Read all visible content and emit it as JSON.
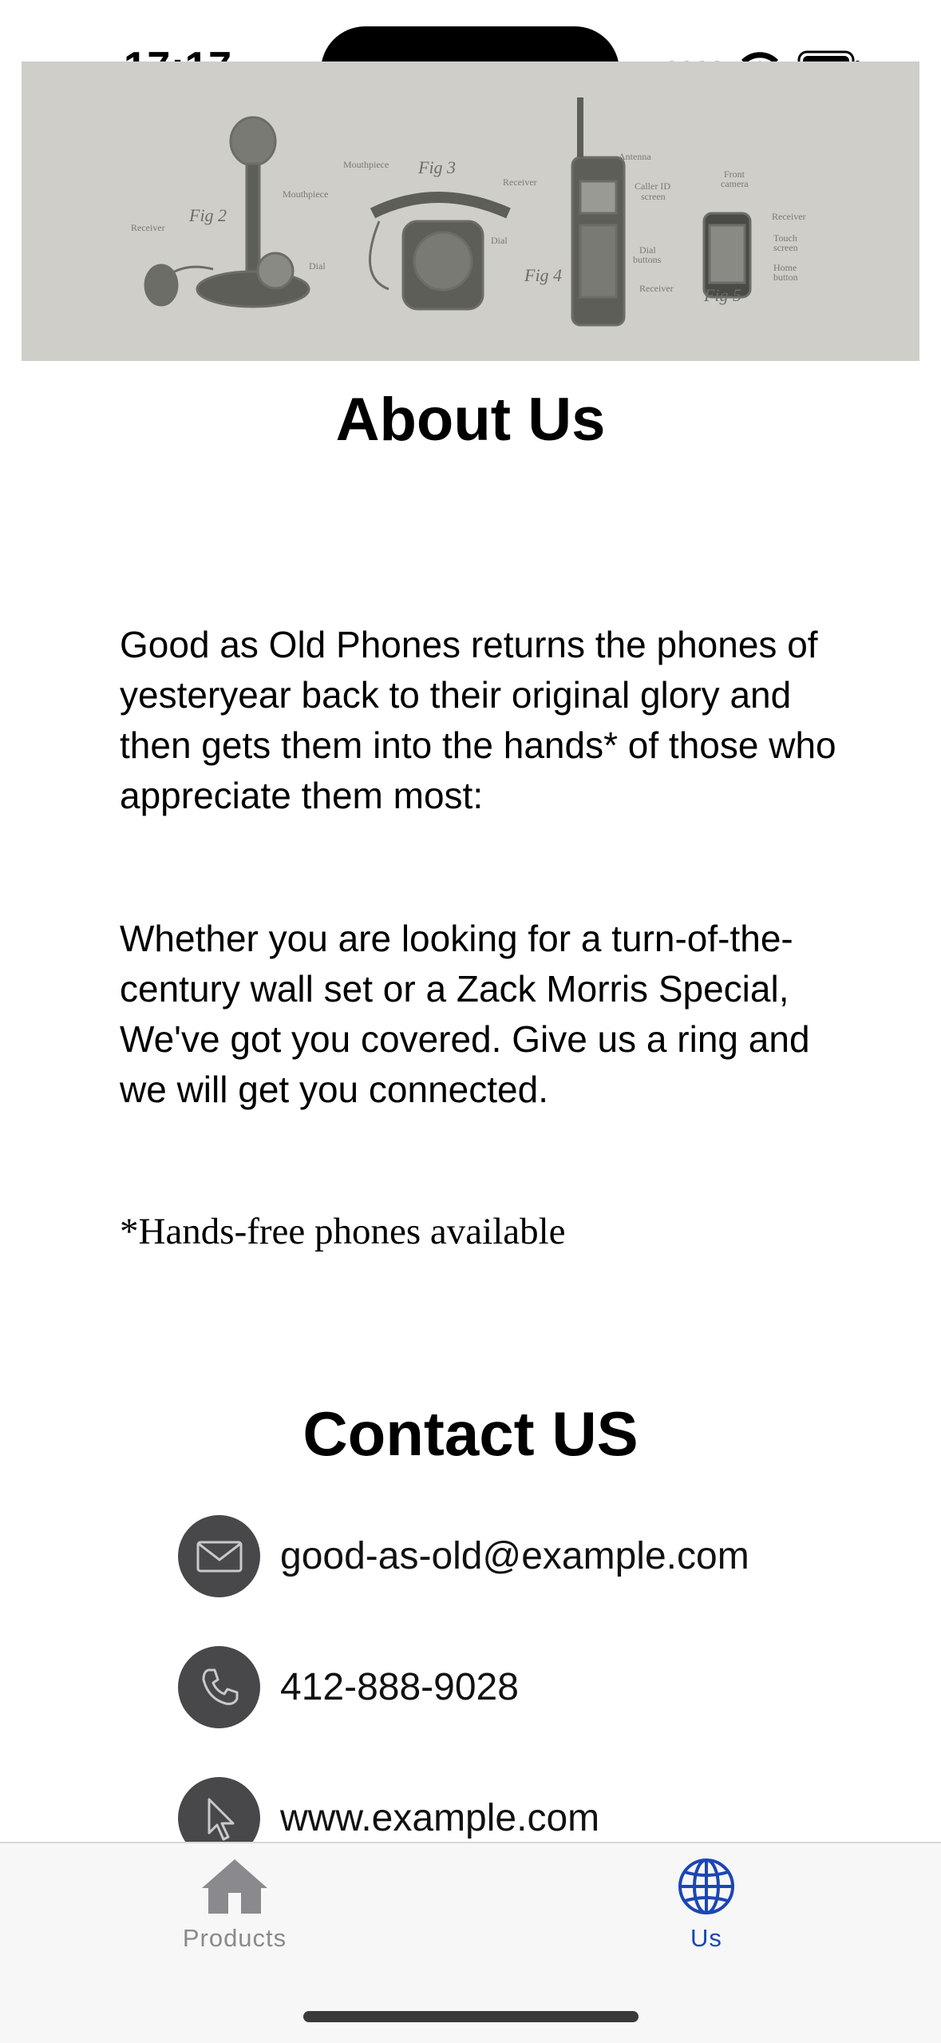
{
  "status_bar": {
    "time": "17:17"
  },
  "hero": {
    "alt": "Vintage telephone illustrations",
    "fig_labels": [
      "Fig 2",
      "Fig 3",
      "Fig 4",
      "Fig 5"
    ],
    "part_labels": [
      "Receiver",
      "Mouthpiece",
      "Dial",
      "Mouthpiece",
      "Receiver",
      "Dial",
      "Antenna",
      "Caller ID screen",
      "Dial buttons",
      "Receiver",
      "Front camera",
      "Receiver",
      "Touch screen",
      "Home button"
    ]
  },
  "about": {
    "title": "About Us",
    "paragraph1": "Good as Old Phones returns the phones of yesteryear back to their original glory and then gets them into the hands* of those who appreciate them most:",
    "paragraph2": "Whether you are looking for a turn-of-the-century wall set or a Zack Morris Special, We've got you covered. Give us a ring and we will get you connected.",
    "footnote": "*Hands-free phones available"
  },
  "contact": {
    "title": "Contact US",
    "email": "good-as-old@example.com",
    "phone": "412-888-9028",
    "website": "www.example.com",
    "icons": [
      "envelope-icon",
      "phone-icon",
      "cursor-icon"
    ]
  },
  "tabbar": {
    "tabs": [
      {
        "label": "Products",
        "icon": "house-icon",
        "selected": false
      },
      {
        "label": "Us",
        "icon": "globe-icon",
        "selected": true
      }
    ],
    "colors": {
      "selected": "#1c46b4",
      "unselected": "#8a8a8e"
    }
  }
}
